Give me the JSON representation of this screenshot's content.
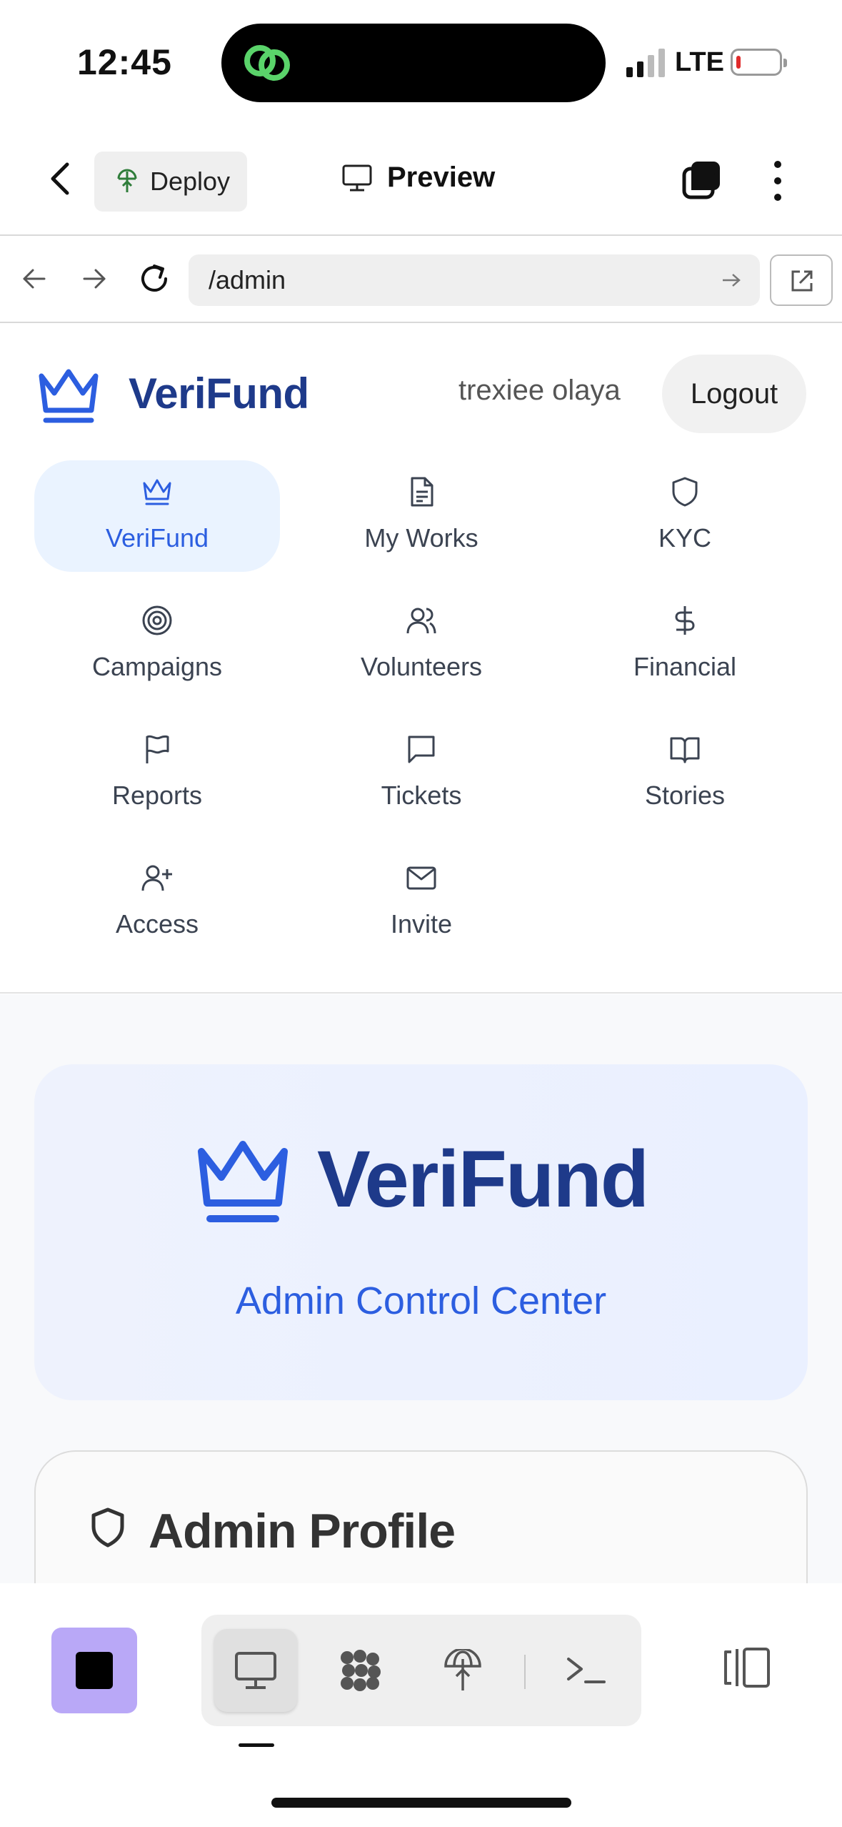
{
  "status_bar": {
    "time": "12:45",
    "network": "LTE"
  },
  "top_bar": {
    "deploy_label": "Deploy",
    "preview_label": "Preview"
  },
  "url_bar": {
    "url": "/admin"
  },
  "app": {
    "brand": "VeriFund",
    "username": "trexiee olaya",
    "logout_label": "Logout",
    "nav_items": [
      {
        "label": "VeriFund",
        "icon": "crown-icon",
        "active": true
      },
      {
        "label": "My Works",
        "icon": "document-icon",
        "active": false
      },
      {
        "label": "KYC",
        "icon": "shield-icon",
        "active": false
      },
      {
        "label": "Campaigns",
        "icon": "target-icon",
        "active": false
      },
      {
        "label": "Volunteers",
        "icon": "users-icon",
        "active": false
      },
      {
        "label": "Financial",
        "icon": "dollar-icon",
        "active": false
      },
      {
        "label": "Reports",
        "icon": "flag-icon",
        "active": false
      },
      {
        "label": "Tickets",
        "icon": "message-icon",
        "active": false
      },
      {
        "label": "Stories",
        "icon": "book-icon",
        "active": false
      },
      {
        "label": "Access",
        "icon": "user-plus-icon",
        "active": false
      },
      {
        "label": "Invite",
        "icon": "mail-icon",
        "active": false
      }
    ]
  },
  "main": {
    "hero_title": "VeriFund",
    "hero_subtitle": "Admin Control Center",
    "profile_title": "Admin Profile"
  },
  "colors": {
    "brand_dark": "#1e3a8a",
    "brand_accent": "#2c5ee0",
    "active_nav_bg": "#eaf3ff",
    "stop_button": "#b9a8f7"
  }
}
